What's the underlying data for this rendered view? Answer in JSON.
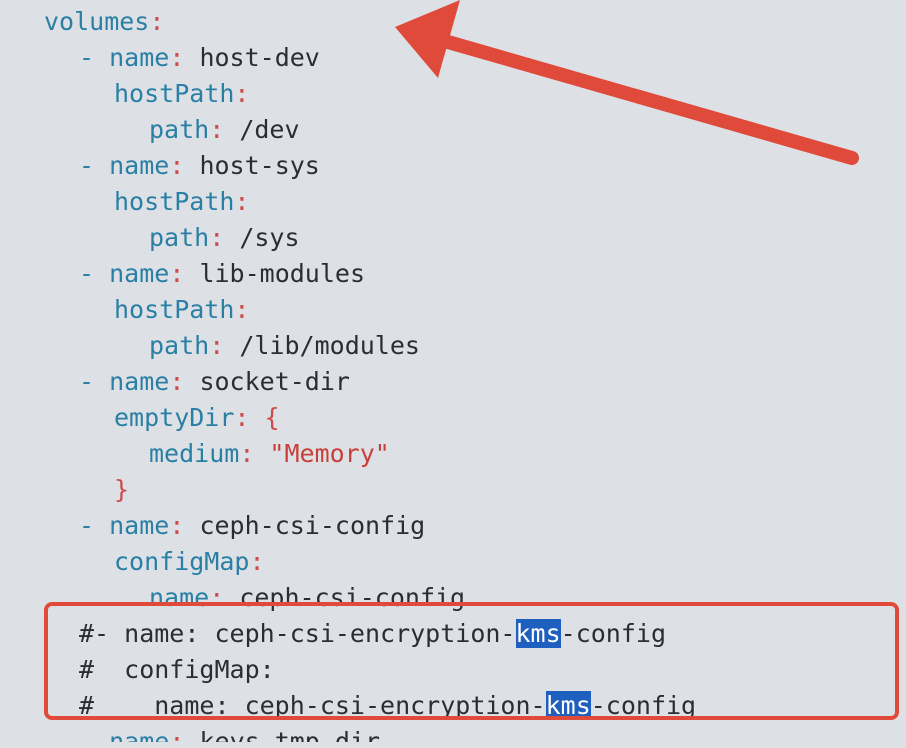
{
  "code": {
    "lines": [
      {
        "indent": 0,
        "tokens": [
          {
            "t": "key",
            "v": "volumes"
          },
          {
            "t": "colon",
            "v": ":"
          }
        ]
      },
      {
        "indent": 1,
        "tokens": [
          {
            "t": "dash",
            "v": "- "
          },
          {
            "t": "key",
            "v": "name"
          },
          {
            "t": "colon",
            "v": ":"
          },
          {
            "t": "val",
            "v": " host-dev"
          }
        ]
      },
      {
        "indent": 2,
        "tokens": [
          {
            "t": "key",
            "v": "hostPath"
          },
          {
            "t": "colon",
            "v": ":"
          }
        ]
      },
      {
        "indent": 3,
        "tokens": [
          {
            "t": "key",
            "v": "path"
          },
          {
            "t": "colon",
            "v": ":"
          },
          {
            "t": "val",
            "v": " /dev"
          }
        ]
      },
      {
        "indent": 1,
        "tokens": [
          {
            "t": "dash",
            "v": "- "
          },
          {
            "t": "key",
            "v": "name"
          },
          {
            "t": "colon",
            "v": ":"
          },
          {
            "t": "val",
            "v": " host-sys"
          }
        ]
      },
      {
        "indent": 2,
        "tokens": [
          {
            "t": "key",
            "v": "hostPath"
          },
          {
            "t": "colon",
            "v": ":"
          }
        ]
      },
      {
        "indent": 3,
        "tokens": [
          {
            "t": "key",
            "v": "path"
          },
          {
            "t": "colon",
            "v": ":"
          },
          {
            "t": "val",
            "v": " /sys"
          }
        ]
      },
      {
        "indent": 1,
        "tokens": [
          {
            "t": "dash",
            "v": "- "
          },
          {
            "t": "key",
            "v": "name"
          },
          {
            "t": "colon",
            "v": ":"
          },
          {
            "t": "val",
            "v": " lib-modules"
          }
        ]
      },
      {
        "indent": 2,
        "tokens": [
          {
            "t": "key",
            "v": "hostPath"
          },
          {
            "t": "colon",
            "v": ":"
          }
        ]
      },
      {
        "indent": 3,
        "tokens": [
          {
            "t": "key",
            "v": "path"
          },
          {
            "t": "colon",
            "v": ":"
          },
          {
            "t": "val",
            "v": " /lib/modules"
          }
        ]
      },
      {
        "indent": 1,
        "tokens": [
          {
            "t": "dash",
            "v": "- "
          },
          {
            "t": "key",
            "v": "name"
          },
          {
            "t": "colon",
            "v": ":"
          },
          {
            "t": "val",
            "v": " socket-dir"
          }
        ]
      },
      {
        "indent": 2,
        "tokens": [
          {
            "t": "key",
            "v": "emptyDir"
          },
          {
            "t": "colon",
            "v": ":"
          },
          {
            "t": "brace",
            "v": " {"
          }
        ]
      },
      {
        "indent": 3,
        "tokens": [
          {
            "t": "key",
            "v": "medium"
          },
          {
            "t": "colon",
            "v": ":"
          },
          {
            "t": "str",
            "v": " \"Memory\""
          }
        ]
      },
      {
        "indent": 2,
        "tokens": [
          {
            "t": "brace",
            "v": "}"
          }
        ]
      },
      {
        "indent": 1,
        "tokens": [
          {
            "t": "dash",
            "v": "- "
          },
          {
            "t": "key",
            "v": "name"
          },
          {
            "t": "colon",
            "v": ":"
          },
          {
            "t": "val",
            "v": " ceph-csi-config"
          }
        ]
      },
      {
        "indent": 2,
        "tokens": [
          {
            "t": "key",
            "v": "configMap"
          },
          {
            "t": "colon",
            "v": ":"
          }
        ]
      },
      {
        "indent": 3,
        "tokens": [
          {
            "t": "key",
            "v": "name"
          },
          {
            "t": "colon",
            "v": ":"
          },
          {
            "t": "val",
            "v": " ceph-csi-config"
          }
        ]
      },
      {
        "indent": 1,
        "tokens": [
          {
            "t": "comment",
            "v": "#- name: ceph-csi-encryption-"
          },
          {
            "t": "hl",
            "v": "kms"
          },
          {
            "t": "comment",
            "v": "-config"
          }
        ]
      },
      {
        "indent": 1,
        "tokens": [
          {
            "t": "comment",
            "v": "#  configMap:"
          }
        ]
      },
      {
        "indent": 1,
        "tokens": [
          {
            "t": "comment",
            "v": "#    name: ceph-csi-encryption-"
          },
          {
            "t": "hl",
            "v": "kms"
          },
          {
            "t": "comment",
            "v": "-config"
          }
        ]
      },
      {
        "indent": 1,
        "cut": true,
        "tokens": [
          {
            "t": "dash",
            "v": "- "
          },
          {
            "t": "key",
            "v": "name"
          },
          {
            "t": "colon",
            "v": ":"
          },
          {
            "t": "val",
            "v": " keys-tmp-dir"
          }
        ]
      }
    ]
  },
  "annotations": {
    "arrow_color": "#e04a3a",
    "box_color": "#e04a3a",
    "highlight_color": "#1f5fbf"
  }
}
